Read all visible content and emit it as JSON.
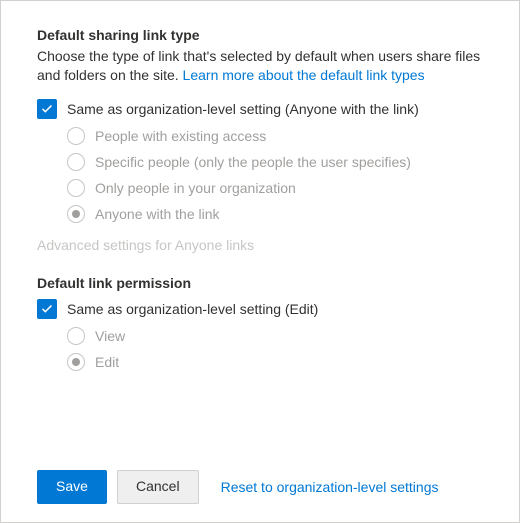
{
  "linkType": {
    "title": "Default sharing link type",
    "description": "Choose the type of link that's selected by default when users share files and folders on the site. ",
    "learn_more": "Learn more about the default link types",
    "same_as_org": "Same as organization-level setting (Anyone with the link)",
    "options": [
      "People with existing access",
      "Specific people (only the people the user specifies)",
      "Only people in your organization",
      "Anyone with the link"
    ],
    "selected_index": 3
  },
  "advanced": "Advanced settings for Anyone links",
  "linkPermission": {
    "title": "Default link permission",
    "same_as_org": "Same as organization-level setting (Edit)",
    "options": [
      "View",
      "Edit"
    ],
    "selected_index": 1
  },
  "footer": {
    "save": "Save",
    "cancel": "Cancel",
    "reset": "Reset to organization-level settings"
  }
}
